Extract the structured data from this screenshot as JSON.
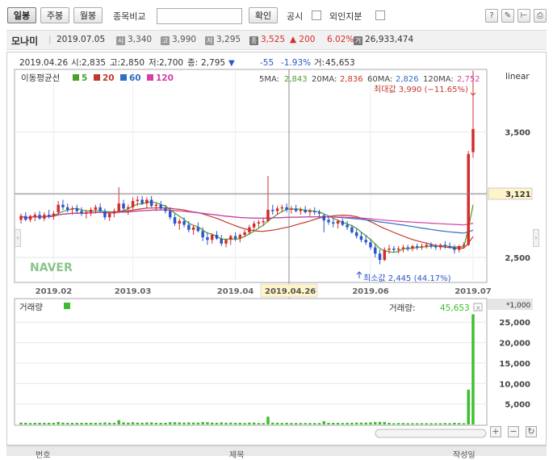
{
  "toolbar": {
    "tabs": [
      "일봉",
      "주봉",
      "월봉"
    ],
    "compare_label": "종목비교",
    "compare_value": "",
    "confirm_label": "확인",
    "disclosure_label": "공시",
    "foreign_label": "외인지분"
  },
  "stock": {
    "name": "모나미",
    "date": "2019.07.05",
    "open_badge": "시",
    "open": "3,340",
    "high_badge": "고",
    "high": "3,990",
    "low_badge": "저",
    "low": "3,295",
    "close_badge": "종",
    "close": "3,525",
    "change": "▲ 200",
    "change_pct": "6.02%",
    "volume_badge": "거",
    "volume": "26,933,474"
  },
  "cursor_info": {
    "date": "2019.04.26",
    "open_label": "시:",
    "open": "2,835",
    "high_label": "고:",
    "high": "2,850",
    "low_label": "저:",
    "low": "2,700",
    "close_label": "종:",
    "close": "2,795",
    "arrow": "▼",
    "change": "-55",
    "change_pct": "-1.93%",
    "volume_label": "거:",
    "volume": "45,653"
  },
  "ma_legend": {
    "label": "이동평균선",
    "items": [
      {
        "name": "5",
        "color": "#4aa02c"
      },
      {
        "name": "20",
        "color": "#c0392b"
      },
      {
        "name": "60",
        "color": "#2e6fc0"
      },
      {
        "name": "120",
        "color": "#d63fa3"
      }
    ]
  },
  "ma_values": {
    "ma5_label": "5MA:",
    "ma5": "2,843",
    "ma20_label": "20MA:",
    "ma20": "2,836",
    "ma60_label": "60MA:",
    "ma60": "2,826",
    "ma120_label": "120MA:",
    "ma120": "2,752"
  },
  "scale_label": "linear",
  "max_label": "최대값 3,990 (−11.65%)",
  "min_label": "최소값 2,445 (44.17%)",
  "current_price_tag": "3,121",
  "cursor_date_tag": "2019.04.26",
  "watermark": "NAVER",
  "volume_panel": {
    "label": "거래량",
    "value_label": "거래량:",
    "value": "45,653",
    "unit": "*1,000"
  },
  "colors": {
    "up": "#d62b2b",
    "down": "#2a56c9",
    "ma5": "#4aa02c",
    "ma20": "#c0392b",
    "ma60": "#2e6fc0",
    "ma120": "#d63fa3",
    "volume": "#3cbf2f"
  },
  "bottom_header": [
    "번호",
    "제목",
    "작성일"
  ],
  "chart_data": {
    "type": "candlestick",
    "price_axis": {
      "ticks": [
        2500,
        3000,
        3500
      ],
      "tick_labels": [
        "2,500",
        "3,000",
        "3,500"
      ],
      "ylim": [
        2300,
        4000
      ]
    },
    "x_tick_labels": [
      "2019.02",
      "2019.03",
      "2019.04",
      "2019.06",
      "2019.07"
    ],
    "dates_range": [
      "2019.01.14",
      "2019.07.05"
    ],
    "candles": [
      [
        2800,
        2850,
        2770,
        2830
      ],
      [
        2830,
        2860,
        2790,
        2800
      ],
      [
        2800,
        2840,
        2780,
        2830
      ],
      [
        2820,
        2860,
        2790,
        2840
      ],
      [
        2840,
        2870,
        2800,
        2810
      ],
      [
        2810,
        2860,
        2790,
        2840
      ],
      [
        2840,
        2880,
        2810,
        2830
      ],
      [
        2830,
        2870,
        2800,
        2850
      ],
      [
        2860,
        2950,
        2840,
        2920
      ],
      [
        2920,
        2960,
        2880,
        2900
      ],
      [
        2900,
        2930,
        2860,
        2880
      ],
      [
        2880,
        2910,
        2840,
        2890
      ],
      [
        2890,
        2920,
        2850,
        2870
      ],
      [
        2870,
        2900,
        2830,
        2850
      ],
      [
        2850,
        2880,
        2810,
        2860
      ],
      [
        2860,
        2900,
        2830,
        2880
      ],
      [
        2880,
        2920,
        2850,
        2900
      ],
      [
        2900,
        2930,
        2860,
        2870
      ],
      [
        2870,
        2890,
        2800,
        2820
      ],
      [
        2820,
        2860,
        2790,
        2850
      ],
      [
        2850,
        2890,
        2820,
        2870
      ],
      [
        2870,
        3060,
        2860,
        2930
      ],
      [
        2930,
        2960,
        2870,
        2890
      ],
      [
        2890,
        2920,
        2840,
        2900
      ],
      [
        2900,
        2980,
        2880,
        2950
      ],
      [
        2950,
        2990,
        2910,
        2960
      ],
      [
        2960,
        2990,
        2920,
        2930
      ],
      [
        2930,
        2980,
        2890,
        2960
      ],
      [
        2960,
        2990,
        2900,
        2910
      ],
      [
        2910,
        2940,
        2870,
        2920
      ],
      [
        2920,
        2950,
        2880,
        2890
      ],
      [
        2890,
        2920,
        2850,
        2870
      ],
      [
        2870,
        2900,
        2800,
        2820
      ],
      [
        2820,
        2850,
        2750,
        2770
      ],
      [
        2770,
        2810,
        2720,
        2790
      ],
      [
        2790,
        2820,
        2740,
        2760
      ],
      [
        2760,
        2790,
        2700,
        2720
      ],
      [
        2720,
        2760,
        2680,
        2740
      ],
      [
        2740,
        2780,
        2700,
        2710
      ],
      [
        2710,
        2740,
        2630,
        2660
      ],
      [
        2660,
        2700,
        2600,
        2640
      ],
      [
        2640,
        2690,
        2610,
        2680
      ],
      [
        2680,
        2710,
        2640,
        2650
      ],
      [
        2650,
        2680,
        2590,
        2610
      ],
      [
        2610,
        2650,
        2580,
        2640
      ],
      [
        2640,
        2680,
        2600,
        2670
      ],
      [
        2670,
        2700,
        2630,
        2650
      ],
      [
        2650,
        2690,
        2620,
        2680
      ],
      [
        2680,
        2720,
        2660,
        2700
      ],
      [
        2700,
        2760,
        2680,
        2740
      ],
      [
        2740,
        2790,
        2710,
        2770
      ],
      [
        2770,
        2800,
        2740,
        2780
      ],
      [
        2780,
        2810,
        2750,
        2790
      ],
      [
        2790,
        3150,
        2780,
        2880
      ],
      [
        2880,
        2920,
        2840,
        2870
      ],
      [
        2870,
        2910,
        2840,
        2890
      ],
      [
        2890,
        2920,
        2860,
        2900
      ],
      [
        2900,
        2930,
        2860,
        2880
      ],
      [
        2880,
        2910,
        2850,
        2890
      ],
      [
        2890,
        2920,
        2860,
        2870
      ],
      [
        2870,
        2900,
        2840,
        2880
      ],
      [
        2880,
        2910,
        2850,
        2860
      ],
      [
        2860,
        2890,
        2830,
        2870
      ],
      [
        2870,
        2900,
        2840,
        2860
      ],
      [
        2860,
        2880,
        2820,
        2850
      ],
      [
        2835,
        2850,
        2700,
        2795
      ],
      [
        2800,
        2830,
        2760,
        2780
      ],
      [
        2780,
        2810,
        2740,
        2770
      ],
      [
        2770,
        2800,
        2730,
        2790
      ],
      [
        2790,
        2810,
        2750,
        2760
      ],
      [
        2760,
        2790,
        2720,
        2740
      ],
      [
        2740,
        2760,
        2690,
        2700
      ],
      [
        2700,
        2730,
        2650,
        2670
      ],
      [
        2670,
        2700,
        2620,
        2640
      ],
      [
        2640,
        2680,
        2600,
        2620
      ],
      [
        2620,
        2650,
        2560,
        2580
      ],
      [
        2580,
        2610,
        2500,
        2530
      ],
      [
        2530,
        2560,
        2445,
        2480
      ],
      [
        2480,
        2580,
        2470,
        2560
      ],
      [
        2560,
        2600,
        2530,
        2570
      ],
      [
        2570,
        2590,
        2540,
        2560
      ],
      [
        2560,
        2590,
        2530,
        2570
      ],
      [
        2570,
        2600,
        2540,
        2580
      ],
      [
        2580,
        2600,
        2550,
        2570
      ],
      [
        2570,
        2600,
        2550,
        2590
      ],
      [
        2590,
        2610,
        2560,
        2580
      ],
      [
        2580,
        2610,
        2560,
        2590
      ],
      [
        2590,
        2620,
        2570,
        2600
      ],
      [
        2600,
        2620,
        2570,
        2590
      ],
      [
        2590,
        2610,
        2560,
        2580
      ],
      [
        2580,
        2610,
        2560,
        2600
      ],
      [
        2600,
        2630,
        2570,
        2590
      ],
      [
        2590,
        2620,
        2570,
        2580
      ],
      [
        2580,
        2600,
        2530,
        2560
      ],
      [
        2560,
        2600,
        2540,
        2590
      ],
      [
        2590,
        2620,
        2570,
        2600
      ],
      [
        2600,
        3350,
        2590,
        3325
      ],
      [
        3340,
        3990,
        3295,
        3525
      ]
    ],
    "volume_axis": {
      "ticks": [
        5000,
        10000,
        15000,
        20000,
        25000
      ],
      "tick_labels": [
        "5,000",
        "10,000",
        "15,000",
        "20,000",
        "25,000"
      ],
      "ylim": [
        0,
        28000
      ],
      "unit": "*1,000"
    }
  }
}
